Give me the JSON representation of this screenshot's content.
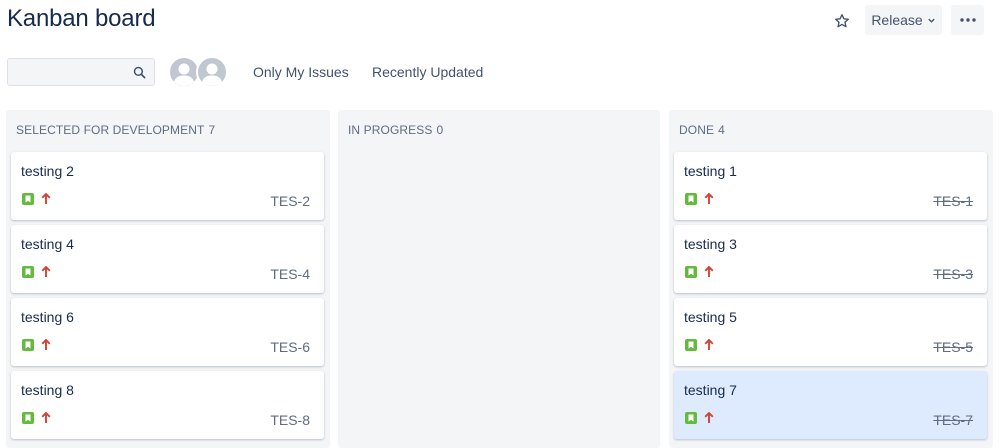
{
  "header": {
    "title": "Kanban board",
    "release_label": "Release"
  },
  "search": {
    "placeholder": "",
    "value": ""
  },
  "filters": {
    "only_my_issues": "Only My Issues",
    "recently_updated": "Recently Updated"
  },
  "colors": {
    "story": "#63ba3c",
    "priority_high": "#d04437",
    "selected_card": "#deebff",
    "column_bg": "#f4f5f7"
  },
  "columns": [
    {
      "title": "SELECTED FOR DEVELOPMENT",
      "count": "7",
      "cards": [
        {
          "title": "testing 2",
          "key": "TES-2",
          "icon_type": "story-icon",
          "priority": "high-priority-arrow-icon"
        },
        {
          "title": "testing 4",
          "key": "TES-4",
          "icon_type": "story-icon",
          "priority": "high-priority-arrow-icon"
        },
        {
          "title": "testing 6",
          "key": "TES-6",
          "icon_type": "story-icon",
          "priority": "high-priority-arrow-icon"
        },
        {
          "title": "testing 8",
          "key": "TES-8",
          "icon_type": "story-icon",
          "priority": "high-priority-arrow-icon"
        }
      ]
    },
    {
      "title": "IN PROGRESS",
      "count": "0",
      "cards": []
    },
    {
      "title": "DONE",
      "count": "4",
      "cards": [
        {
          "title": "testing 1",
          "key": "TES-1",
          "icon_type": "story-icon",
          "priority": "high-priority-arrow-icon"
        },
        {
          "title": "testing 3",
          "key": "TES-3",
          "icon_type": "story-icon",
          "priority": "high-priority-arrow-icon"
        },
        {
          "title": "testing 5",
          "key": "TES-5",
          "icon_type": "story-icon",
          "priority": "high-priority-arrow-icon"
        },
        {
          "title": "testing 7",
          "key": "TES-7",
          "icon_type": "story-icon",
          "priority": "high-priority-arrow-icon",
          "selected": true
        }
      ]
    }
  ]
}
